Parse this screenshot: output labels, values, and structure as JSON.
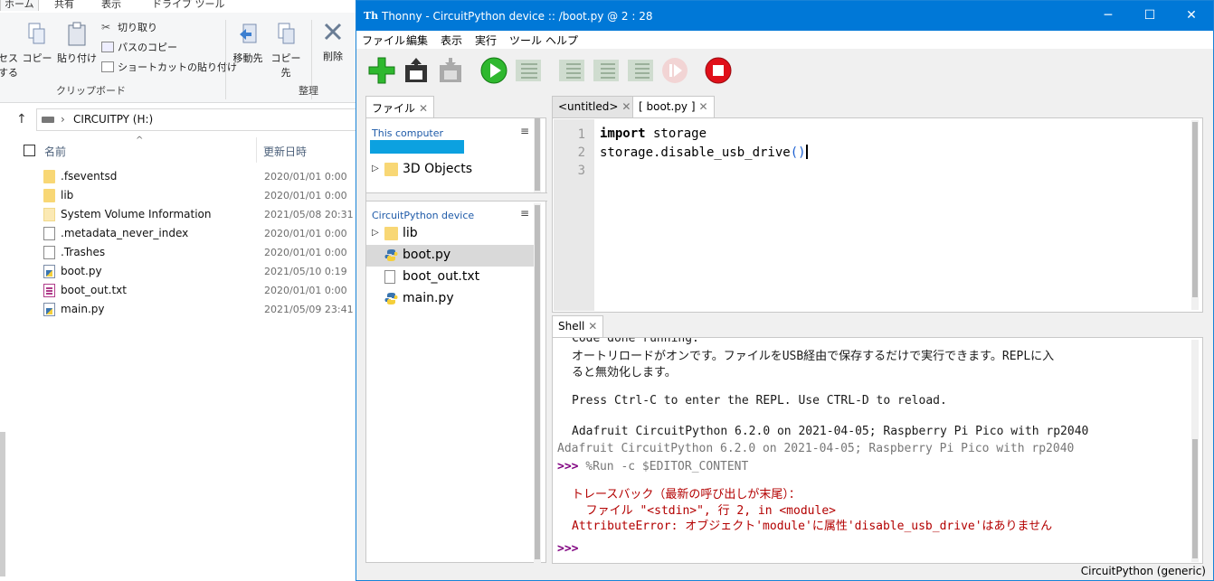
{
  "explorer": {
    "ribbon_tabs": [
      "ホーム",
      "共有",
      "表示",
      "ドライブ ツール"
    ],
    "clipboard": {
      "access_label_line1": "セス",
      "access_label_line2": "する",
      "copy": "コピー",
      "paste": "貼り付け",
      "cut": "切り取り",
      "copy_path": "パスのコピー",
      "paste_shortcut": "ショートカットの貼り付け",
      "group_label": "クリップボード"
    },
    "organize": {
      "move_to": "移動先",
      "copy_to": "コピー先",
      "delete": "削除",
      "group_label": "整理"
    },
    "address": {
      "crumb": "CIRCUITPY (H:)"
    },
    "columns": {
      "name": "名前",
      "date": "更新日時"
    },
    "files": [
      {
        "name": ".fseventsd",
        "date": "2020/01/01 0:00",
        "icon": "folder-icon"
      },
      {
        "name": "lib",
        "date": "2020/01/01 0:00",
        "icon": "folder-icon"
      },
      {
        "name": "System Volume Information",
        "date": "2021/05/08 20:31",
        "icon": "folder-icon"
      },
      {
        "name": ".metadata_never_index",
        "date": "2020/01/01 0:00",
        "icon": "file-icon"
      },
      {
        "name": ".Trashes",
        "date": "2020/01/01 0:00",
        "icon": "file-icon"
      },
      {
        "name": "boot.py",
        "date": "2021/05/10 0:19",
        "icon": "python-file-icon"
      },
      {
        "name": "boot_out.txt",
        "date": "2020/01/01 0:00",
        "icon": "text-file-icon"
      },
      {
        "name": "main.py",
        "date": "2021/05/09 23:41",
        "icon": "python-file-icon"
      }
    ]
  },
  "thonny": {
    "window_title": "Thonny  -  CircuitPython device :: /boot.py  @  2 : 28",
    "menu": [
      "ファイル",
      "編集",
      "表示",
      "実行",
      "ツール",
      "ヘルプ"
    ],
    "files_tab": "ファイル",
    "this_computer": "This computer",
    "this_computer_tree": [
      {
        "label": "3D Objects",
        "icon": "folder-icon"
      }
    ],
    "device_title": "CircuitPython device",
    "device_tree": [
      {
        "label": "lib",
        "icon": "folder-icon",
        "expandable": true,
        "selected": false
      },
      {
        "label": "boot.py",
        "icon": "python-file-icon",
        "selected": true
      },
      {
        "label": "boot_out.txt",
        "icon": "text-file-icon",
        "selected": false
      },
      {
        "label": "main.py",
        "icon": "python-file-icon",
        "selected": false
      }
    ],
    "editor_tabs": [
      "<untitled>",
      "[ boot.py ]"
    ],
    "line_numbers": [
      "1",
      "2",
      "3"
    ],
    "code": {
      "line1_kw": "import",
      "line1_rest": " storage",
      "line2_main": "storage.disable_usb_drive",
      "line2_open": "(",
      "line2_close": ")"
    },
    "shell_tab": "Shell",
    "shell": {
      "partial_top": "Code done running.",
      "autoreload_1": "オートリロードがオンです。ファイルをUSB経由で保存するだけで実行できます。REPLに入",
      "autoreload_2": "ると無効化します。",
      "press_ctrl": "Press Ctrl-C to enter the REPL. Use CTRL-D to reload.",
      "banner1": "Adafruit CircuitPython 6.2.0 on 2021-04-05; Raspberry Pi Pico with rp2040",
      "banner2": "Adafruit CircuitPython 6.2.0 on 2021-04-05; Raspberry Pi Pico with rp2040",
      "prompt": ">>> ",
      "run_cmd": "%Run -c $EDITOR_CONTENT",
      "tb1": "トレースバック（最新の呼び出しが末尾）：",
      "tb2": "  ファイル \"<stdin>\", 行 2, in <module>",
      "tb3": "AttributeError: オブジェクト'module'に属性'disable_usb_drive'はありません",
      "final_prompt": ">>>"
    },
    "status": "CircuitPython (generic)"
  }
}
